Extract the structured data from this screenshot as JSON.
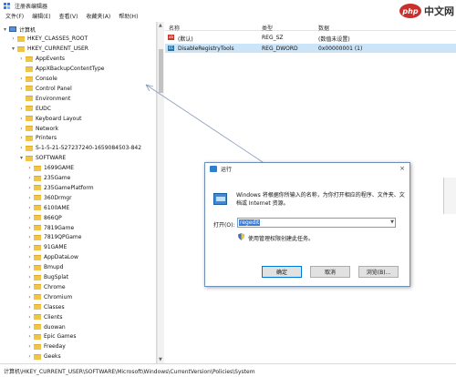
{
  "window": {
    "title": "注册表编辑器",
    "menu": [
      "文件(F)",
      "编辑(E)",
      "查看(V)",
      "收藏夹(A)",
      "帮助(H)"
    ]
  },
  "watermark": {
    "badge": "php",
    "text": "中文网"
  },
  "tree": {
    "items": [
      {
        "label": "计算机",
        "indent": 0,
        "arrow": "▾",
        "icon": "pc"
      },
      {
        "label": "HKEY_CLASSES_ROOT",
        "indent": 1,
        "arrow": "›",
        "icon": "folder"
      },
      {
        "label": "HKEY_CURRENT_USER",
        "indent": 1,
        "arrow": "▾",
        "icon": "folder"
      },
      {
        "label": "AppEvents",
        "indent": 2,
        "arrow": "›",
        "icon": "folder"
      },
      {
        "label": "AppXBackupContentType",
        "indent": 2,
        "arrow": "",
        "icon": "folder"
      },
      {
        "label": "Console",
        "indent": 2,
        "arrow": "›",
        "icon": "folder"
      },
      {
        "label": "Control Panel",
        "indent": 2,
        "arrow": "›",
        "icon": "folder"
      },
      {
        "label": "Environment",
        "indent": 2,
        "arrow": "",
        "icon": "folder"
      },
      {
        "label": "EUDC",
        "indent": 2,
        "arrow": "›",
        "icon": "folder"
      },
      {
        "label": "Keyboard Layout",
        "indent": 2,
        "arrow": "›",
        "icon": "folder"
      },
      {
        "label": "Network",
        "indent": 2,
        "arrow": "›",
        "icon": "folder"
      },
      {
        "label": "Printers",
        "indent": 2,
        "arrow": "›",
        "icon": "folder"
      },
      {
        "label": "S-1-5-21-527237240-1659084503-842",
        "indent": 2,
        "arrow": "›",
        "icon": "folder"
      },
      {
        "label": "SOFTWARE",
        "indent": 2,
        "arrow": "▾",
        "icon": "folder"
      },
      {
        "label": "1699GAME",
        "indent": 3,
        "arrow": "›",
        "icon": "folder"
      },
      {
        "label": "235Game",
        "indent": 3,
        "arrow": "›",
        "icon": "folder"
      },
      {
        "label": "235GamePlatform",
        "indent": 3,
        "arrow": "›",
        "icon": "folder"
      },
      {
        "label": "360Drmgr",
        "indent": 3,
        "arrow": "›",
        "icon": "folder"
      },
      {
        "label": "6100AME",
        "indent": 3,
        "arrow": "›",
        "icon": "folder"
      },
      {
        "label": "866QP",
        "indent": 3,
        "arrow": "›",
        "icon": "folder"
      },
      {
        "label": "7819Game",
        "indent": 3,
        "arrow": "›",
        "icon": "folder"
      },
      {
        "label": "7819QPGame",
        "indent": 3,
        "arrow": "›",
        "icon": "folder"
      },
      {
        "label": "91GAME",
        "indent": 3,
        "arrow": "›",
        "icon": "folder"
      },
      {
        "label": "AppDataLow",
        "indent": 3,
        "arrow": "›",
        "icon": "folder"
      },
      {
        "label": "Bmupd",
        "indent": 3,
        "arrow": "›",
        "icon": "folder"
      },
      {
        "label": "BugSplat",
        "indent": 3,
        "arrow": "›",
        "icon": "folder"
      },
      {
        "label": "Chrome",
        "indent": 3,
        "arrow": "›",
        "icon": "folder"
      },
      {
        "label": "Chromium",
        "indent": 3,
        "arrow": "›",
        "icon": "folder"
      },
      {
        "label": "Classes",
        "indent": 3,
        "arrow": "›",
        "icon": "folder"
      },
      {
        "label": "Clients",
        "indent": 3,
        "arrow": "›",
        "icon": "folder"
      },
      {
        "label": "duowan",
        "indent": 3,
        "arrow": "›",
        "icon": "folder"
      },
      {
        "label": "Epic Games",
        "indent": 3,
        "arrow": "›",
        "icon": "folder"
      },
      {
        "label": "Freeday",
        "indent": 3,
        "arrow": "›",
        "icon": "folder"
      },
      {
        "label": "Geeks",
        "indent": 3,
        "arrow": "›",
        "icon": "folder"
      }
    ]
  },
  "list": {
    "columns": [
      "名称",
      "类型",
      "数据"
    ],
    "rows": [
      {
        "name": "(默认)",
        "type": "REG_SZ",
        "data": "(数值未设置)",
        "icon": "str",
        "icon_text": "ab",
        "selected": false
      },
      {
        "name": "DisableRegistryTools",
        "type": "REG_DWORD",
        "data": "0x00000001 (1)",
        "icon": "bin",
        "icon_text": "01",
        "selected": true
      }
    ]
  },
  "status": {
    "path": "计算机\\HKEY_CURRENT_USER\\SOFTWARE\\Microsoft\\Windows\\CurrentVersion\\Policies\\System"
  },
  "run": {
    "title": "运行",
    "close": "×",
    "description": "Windows 将根据你所输入的名称，为你打开相应的程序、文件夹、文档或 Internet 资源。",
    "open_label": "打开(O):",
    "input_value": "regedit",
    "admin_note": "使用管理权限创建此任务。",
    "buttons": {
      "ok": "确定",
      "cancel": "取消",
      "browse": "浏览(B)..."
    }
  },
  "colors": {
    "accent": "#0078d7",
    "selection": "#cce4f7",
    "folder": "#f0c64a"
  }
}
